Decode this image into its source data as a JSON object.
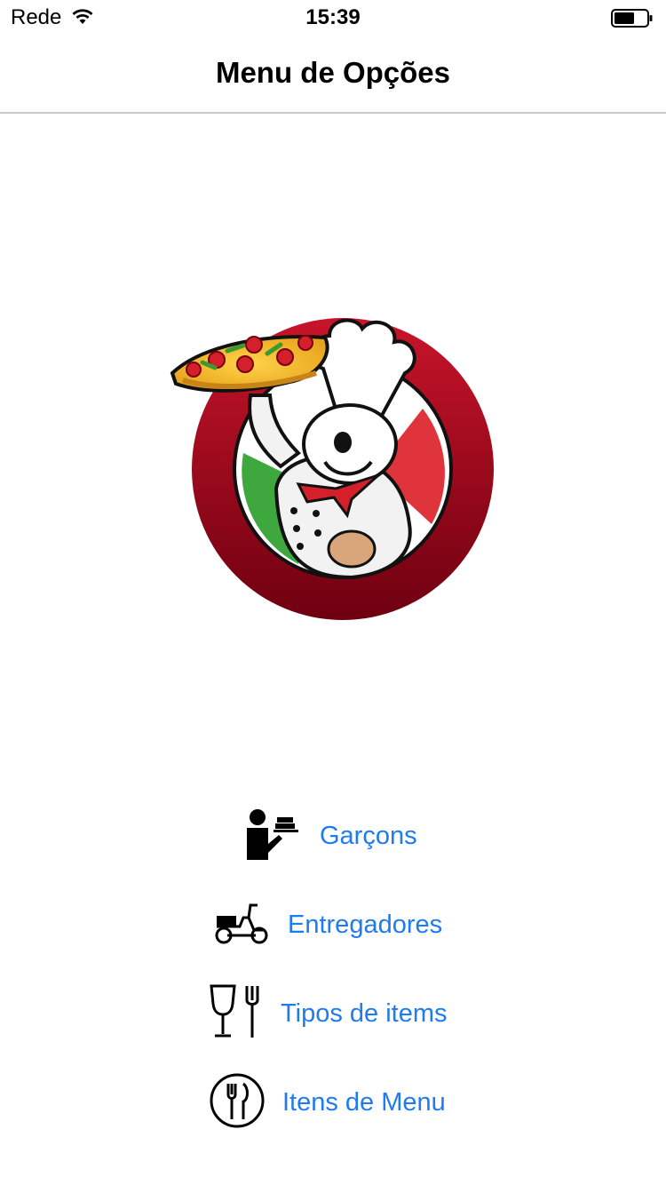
{
  "status": {
    "carrier": "Rede",
    "time": "15:39",
    "icons": [
      "wifi-icon",
      "battery-icon"
    ]
  },
  "nav": {
    "title": "Menu de Opções"
  },
  "logo": {
    "icon": "chef-pizza-logo"
  },
  "menu": {
    "accent_color": "#1f7bf0",
    "items": [
      {
        "label": "Garçons",
        "icon": "waiter-icon"
      },
      {
        "label": "Entregadores",
        "icon": "scooter-icon"
      },
      {
        "label": "Tipos de items",
        "icon": "glass-fork-icon"
      },
      {
        "label": "Itens de Menu",
        "icon": "cutlery-icon"
      }
    ]
  }
}
